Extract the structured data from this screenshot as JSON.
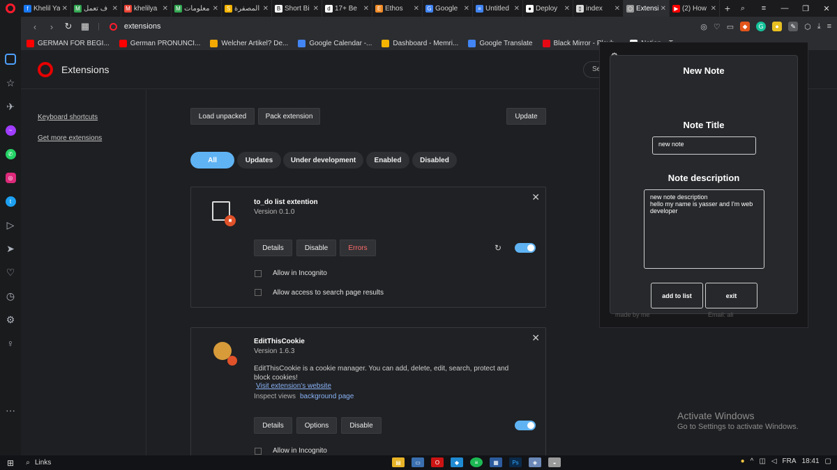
{
  "tabs": [
    {
      "label": "Khelil Ya",
      "color": "#1877f2",
      "glyph": "f"
    },
    {
      "label": "ف تعمل",
      "color": "#34a853",
      "glyph": "M"
    },
    {
      "label": "khelilya",
      "color": "#ea4335",
      "glyph": "M"
    },
    {
      "label": "معلومات",
      "color": "#34a853",
      "glyph": "M"
    },
    {
      "label": "المصفرة",
      "color": "#f4b400",
      "glyph": "S"
    },
    {
      "label": "Short Bi",
      "color": "#ffffff",
      "glyph": "B"
    },
    {
      "label": "17+ Be",
      "color": "#ffffff",
      "glyph": "d"
    },
    {
      "label": "Ethos",
      "color": "#f28c28",
      "glyph": "E"
    },
    {
      "label": "Google",
      "color": "#4285f4",
      "glyph": "G"
    },
    {
      "label": "Untitled",
      "color": "#4285f4",
      "glyph": "≡"
    },
    {
      "label": "Deploy",
      "color": "#ffffff",
      "glyph": "●"
    },
    {
      "label": "index",
      "color": "#dddddd",
      "glyph": "▯"
    },
    {
      "label": "Extensi",
      "color": "#999999",
      "glyph": "⬡"
    },
    {
      "label": "(2) How",
      "color": "#ff0000",
      "glyph": "▶"
    }
  ],
  "address": {
    "url": "extensions"
  },
  "bookmarks": [
    {
      "label": "GERMAN FOR BEGI...",
      "color": "#ff0000"
    },
    {
      "label": "German PRONUNCI...",
      "color": "#ff0000"
    },
    {
      "label": "Welcher Artikel? De...",
      "color": "#f2a900"
    },
    {
      "label": "Google Calendar -...",
      "color": "#4285f4"
    },
    {
      "label": "Dashboard - Memri...",
      "color": "#f4b400"
    },
    {
      "label": "Google Translate",
      "color": "#4285f4"
    },
    {
      "label": "Black Mirror - Playb...",
      "color": "#e50914"
    },
    {
      "label": "Notion – T",
      "color": "#ffffff"
    }
  ],
  "header": {
    "title": "Extensions",
    "search_label": "Se"
  },
  "left_nav": {
    "keyboard": "Keyboard shortcuts",
    "more": "Get more extensions"
  },
  "toolbar": {
    "load": "Load unpacked",
    "pack": "Pack extension",
    "update": "Update"
  },
  "filters": {
    "all": "All",
    "updates": "Updates",
    "dev": "Under development",
    "enabled": "Enabled",
    "disabled": "Disabled"
  },
  "ext1": {
    "name": "to_do list extention",
    "version": "Version 0.1.0",
    "details": "Details",
    "disable": "Disable",
    "errors": "Errors",
    "incognito": "Allow in Incognito",
    "search": "Allow access to search page results",
    "enabled": true
  },
  "ext2": {
    "name": "EditThisCookie",
    "version": "Version 1.6.3",
    "desc": "EditThisCookie is a cookie manager. You can add, delete, edit, search, protect and block cookies!",
    "website": "Visit extension's website",
    "inspect": "Inspect views",
    "background": "background page",
    "details": "Details",
    "options": "Options",
    "disable": "Disable",
    "incognito": "Allow in Incognito",
    "enabled": true
  },
  "popup": {
    "title": "New Note",
    "note_title_label": "Note Title",
    "note_title_value": "new note",
    "desc_label": "Note description",
    "desc_value": "new note description\nhello my name is yasser and I'm web developer",
    "add": "add to list",
    "exit": "exit",
    "footer_left": "made by me",
    "footer_right": "Email: ali"
  },
  "watermark": {
    "title": "Activate Windows",
    "sub": "Go to Settings to activate Windows."
  },
  "taskbar": {
    "search": "Links",
    "lang": "FRA",
    "time": "18:41"
  }
}
